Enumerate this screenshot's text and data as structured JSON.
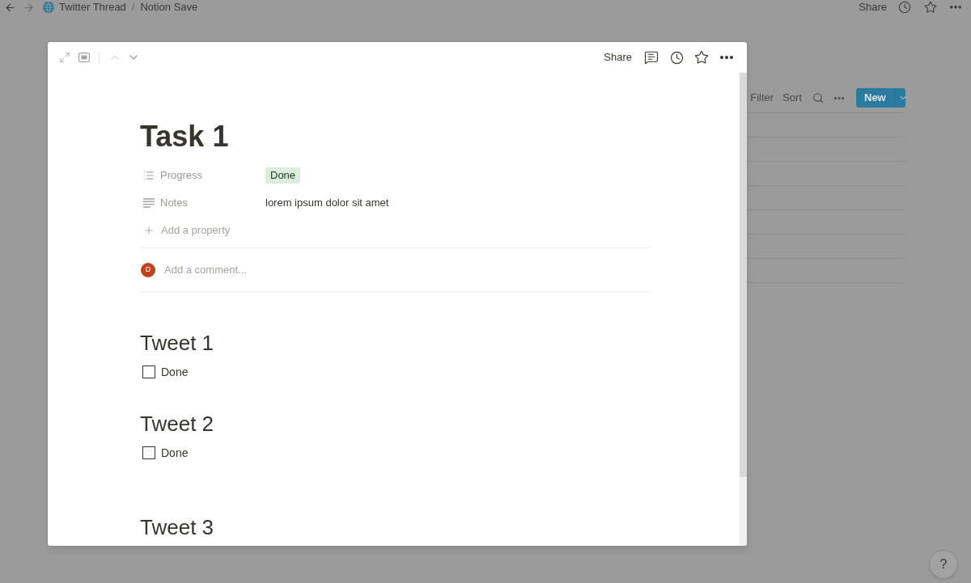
{
  "topbar": {
    "breadcrumbs": [
      "Twitter Thread",
      "Notion Save"
    ],
    "separator": "/",
    "share": "Share"
  },
  "database": {
    "filter": "Filter",
    "sort": "Sort",
    "new_button": "New"
  },
  "modal": {
    "page_nav": {
      "up_disabled": true,
      "down_disabled": false
    },
    "share": "Share",
    "title": "Task 1",
    "properties": [
      {
        "kind": "select",
        "label": "Progress",
        "value": "Done"
      },
      {
        "kind": "text",
        "label": "Notes",
        "value": "lorem ipsum dolor sit amet"
      }
    ],
    "add_property": "Add a property",
    "comment": {
      "avatar": "D",
      "placeholder": "Add a comment..."
    },
    "blocks": [
      {
        "kind": "heading",
        "text": "Tweet 1"
      },
      {
        "kind": "todo",
        "text": "Done",
        "checked": false
      },
      {
        "kind": "heading",
        "text": "Tweet 2"
      },
      {
        "kind": "todo",
        "text": "Done",
        "checked": false
      },
      {
        "kind": "spacer"
      },
      {
        "kind": "heading",
        "text": "Tweet 3"
      }
    ]
  },
  "help": "?"
}
